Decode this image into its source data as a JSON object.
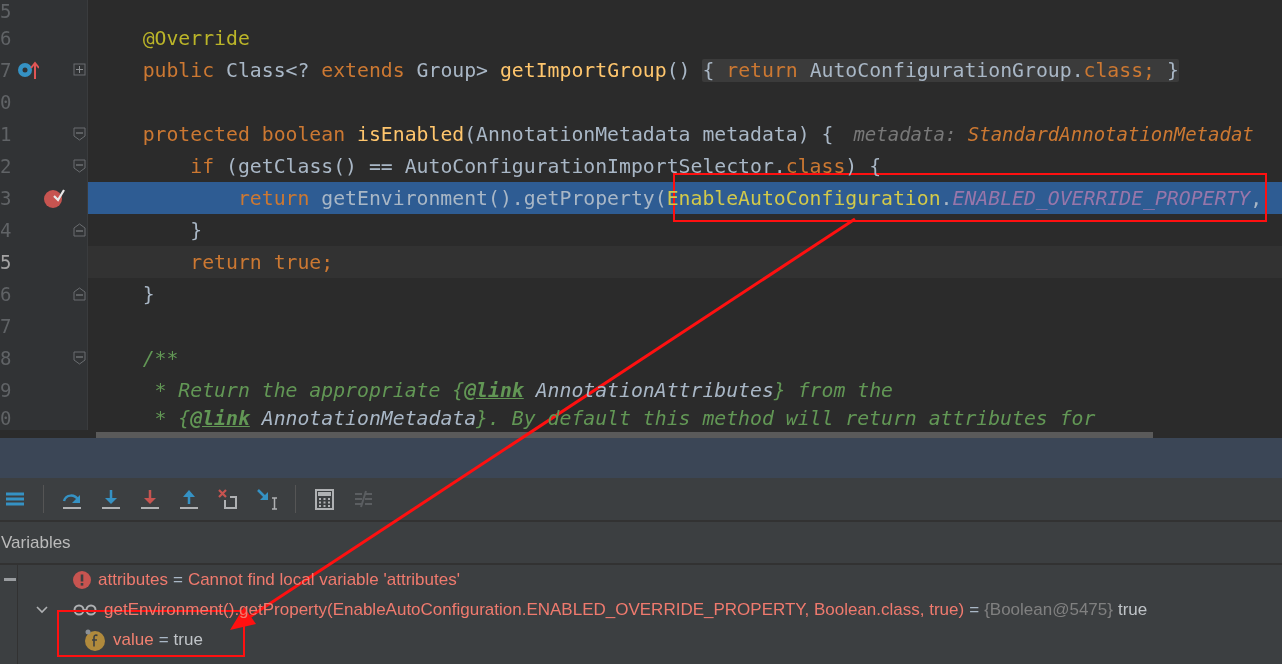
{
  "editor": {
    "lines": [
      {
        "number": "5"
      },
      {
        "number": "6",
        "segments": [
          {
            "kind": "code",
            "tokens": [
              {
                "kind": "annotation",
                "text": "    @Override"
              }
            ]
          }
        ]
      },
      {
        "number": "7",
        "gutter_icons": [
          {
            "kind": "override"
          }
        ],
        "fold": {
          "kind": "plus"
        },
        "segments": [
          {
            "kind": "code",
            "tokens": [
              {
                "kind": "keyword",
                "text": "    public "
              },
              {
                "kind": "plain",
                "text": "Class<? "
              },
              {
                "kind": "keyword",
                "text": "extends "
              },
              {
                "kind": "plain",
                "text": "Group> "
              },
              {
                "kind": "method",
                "text": "getImportGroup"
              },
              {
                "kind": "plain",
                "text": "() "
              }
            ]
          },
          {
            "kind": "fold",
            "tokens": [
              {
                "kind": "plain",
                "text": "{ "
              },
              {
                "kind": "keyword",
                "text": "return "
              },
              {
                "kind": "plain",
                "text": "AutoConfigurationGroup."
              },
              {
                "kind": "keyword",
                "text": "class;"
              },
              {
                "kind": "plain",
                "text": " }"
              }
            ]
          }
        ]
      },
      {
        "number": "0"
      },
      {
        "number": "1",
        "fold": {
          "kind": "start"
        },
        "segments": [
          {
            "kind": "code",
            "tokens": [
              {
                "kind": "keyword",
                "text": "    protected boolean "
              },
              {
                "kind": "method",
                "text": "isEnabled"
              },
              {
                "kind": "plain",
                "text": "(AnnotationMetadata metadata) {"
              }
            ]
          },
          {
            "kind": "hint",
            "tokens": [
              {
                "kind": "hint-label",
                "text": "metadata: "
              },
              {
                "kind": "hint-type",
                "text": "StandardAnnotationMetadat"
              }
            ]
          }
        ]
      },
      {
        "number": "2",
        "fold": {
          "kind": "start"
        },
        "segments": [
          {
            "kind": "code",
            "tokens": [
              {
                "kind": "keyword",
                "text": "        if "
              },
              {
                "kind": "plain",
                "text": "(getClass() == AutoConfigurationImportSelector."
              },
              {
                "kind": "keyword",
                "text": "class"
              },
              {
                "kind": "plain",
                "text": ") {"
              }
            ]
          }
        ]
      },
      {
        "number": "3",
        "gutter_icons": [
          {
            "kind": "breakpoint"
          }
        ],
        "current": true,
        "segments": [
          {
            "kind": "code",
            "tokens": [
              {
                "kind": "keyword",
                "text": "            return "
              },
              {
                "kind": "plain",
                "text": "getEnvironment().getProperty("
              },
              {
                "kind": "type-ref",
                "text": "EnableAutoConfiguration"
              },
              {
                "kind": "plain",
                "text": "."
              },
              {
                "kind": "constant",
                "text": "ENABLED_OVERRIDE_PROPERTY"
              },
              {
                "kind": "plain",
                "text": ","
              }
            ]
          }
        ]
      },
      {
        "number": "4",
        "fold": {
          "kind": "end"
        },
        "segments": [
          {
            "kind": "code",
            "tokens": [
              {
                "kind": "plain",
                "text": "        }"
              }
            ]
          }
        ]
      },
      {
        "number": "5",
        "caret": true,
        "segments": [
          {
            "kind": "code",
            "tokens": [
              {
                "kind": "keyword",
                "text": "        return true;"
              }
            ]
          }
        ]
      },
      {
        "number": "6",
        "fold": {
          "kind": "end"
        },
        "segments": [
          {
            "kind": "code",
            "tokens": [
              {
                "kind": "plain",
                "text": "    }"
              }
            ]
          }
        ]
      },
      {
        "number": "7"
      },
      {
        "number": "8",
        "fold": {
          "kind": "start"
        },
        "segments": [
          {
            "kind": "code",
            "tokens": [
              {
                "kind": "comment",
                "text": "    /**"
              }
            ]
          }
        ]
      },
      {
        "number": "9",
        "segments": [
          {
            "kind": "code",
            "tokens": [
              {
                "kind": "comment",
                "text": "     * Return the appropriate {"
              },
              {
                "kind": "doc-tag",
                "text": "@link"
              },
              {
                "kind": "doc-ref",
                "text": " AnnotationAttributes"
              },
              {
                "kind": "comment",
                "text": "} from the"
              }
            ]
          }
        ]
      },
      {
        "number": "0",
        "segments": [
          {
            "kind": "code",
            "tokens": [
              {
                "kind": "comment",
                "text": "     * {"
              },
              {
                "kind": "doc-tag",
                "text": "@link"
              },
              {
                "kind": "doc-ref",
                "text": " AnnotationMetadata"
              },
              {
                "kind": "comment",
                "text": "}. By default this method will return attributes for"
              }
            ]
          }
        ]
      }
    ]
  },
  "debugger": {
    "toolbar": [
      {
        "kind": "frames"
      },
      {
        "kind": "separator"
      },
      {
        "kind": "step-over"
      },
      {
        "kind": "step-into"
      },
      {
        "kind": "force-step-into"
      },
      {
        "kind": "step-out"
      },
      {
        "kind": "drop-frame"
      },
      {
        "kind": "run-to-cursor"
      },
      {
        "kind": "separator"
      },
      {
        "kind": "evaluate"
      },
      {
        "kind": "trace",
        "disabled": true
      }
    ],
    "variables_title": "Variables",
    "variables": [
      {
        "kind": "error",
        "name": "attributes",
        "operator": "=",
        "value": "Cannot find local variable 'attributes'"
      },
      {
        "kind": "watch",
        "expanded": true,
        "name": "getEnvironment().getProperty(EnableAutoConfiguration.ENABLED_OVERRIDE_PROPERTY, Boolean.class, true)",
        "operator": "=",
        "type": "{Boolean@5475}",
        "value": "true",
        "children": [
          {
            "kind": "field",
            "name": "value",
            "operator": "=",
            "value": "true"
          }
        ]
      }
    ]
  }
}
